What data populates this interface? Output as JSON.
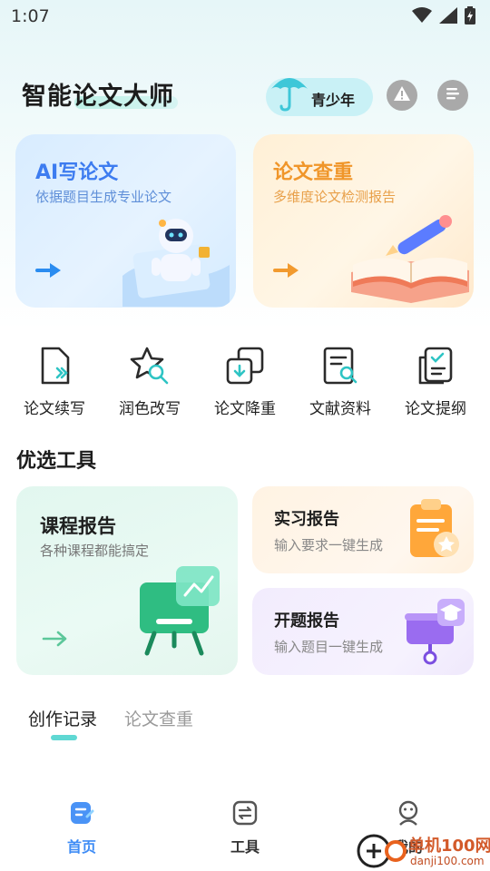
{
  "status_bar": {
    "time": "1:07"
  },
  "header": {
    "app_title": "智能论文大师",
    "teen_mode_label": "青少年",
    "buttons": [
      "alert-icon",
      "menu-icon"
    ]
  },
  "hero_cards": [
    {
      "title": "AI写论文",
      "subtitle": "依据题目生成专业论文",
      "accent": "#3d7cf0"
    },
    {
      "title": "论文查重",
      "subtitle": "多维度论文检测报告",
      "accent": "#f0962a"
    }
  ],
  "quick_tools": [
    {
      "label": "论文续写",
      "icon": "document-continue-icon"
    },
    {
      "label": "润色改写",
      "icon": "polish-star-icon"
    },
    {
      "label": "论文降重",
      "icon": "reduce-duplicate-icon"
    },
    {
      "label": "文献资料",
      "icon": "literature-search-icon"
    },
    {
      "label": "论文提纲",
      "icon": "outline-checklist-icon"
    }
  ],
  "featured": {
    "section_title": "优选工具",
    "course_report": {
      "title": "课程报告",
      "subtitle": "各种课程都能搞定"
    },
    "internship_report": {
      "title": "实习报告",
      "subtitle": "输入要求一键生成"
    },
    "proposal_report": {
      "title": "开题报告",
      "subtitle": "输入题目一键生成"
    }
  },
  "record_tabs": [
    {
      "label": "创作记录",
      "active": true
    },
    {
      "label": "论文查重",
      "active": false
    }
  ],
  "bottom_nav": [
    {
      "label": "首页",
      "icon": "home-icon",
      "active": true,
      "color": "#3e8cf5"
    },
    {
      "label": "工具",
      "icon": "tools-icon",
      "active": false,
      "color": "#333333"
    },
    {
      "label": "我的",
      "icon": "profile-icon",
      "active": false,
      "color": "#333333"
    }
  ],
  "watermark": {
    "text": "单机100网",
    "domain": "danji100.com"
  }
}
